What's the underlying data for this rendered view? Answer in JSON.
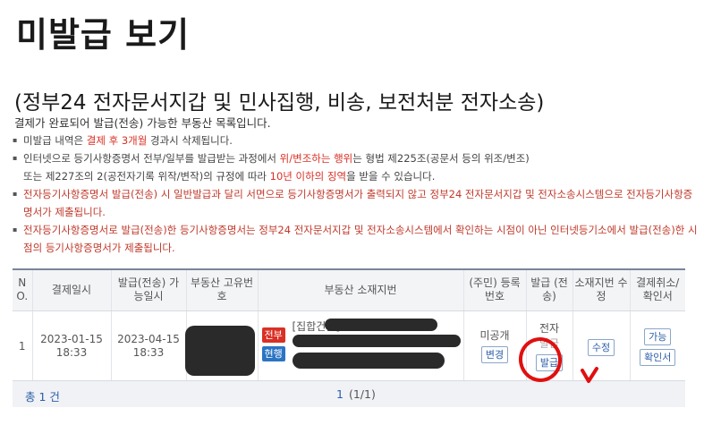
{
  "page": {
    "title": "미발급 보기",
    "section_title": "(정부24 전자문서지갑 및 민사집행, 비송, 보전처분 전자소송)",
    "intro": "결제가 완료되어 발급(전송) 가능한 부동산 목록입니다."
  },
  "notes": {
    "n1_a": "미발급 내역은 ",
    "n1_b": "결제 후 3개월",
    "n1_c": " 경과시 삭제됩니다.",
    "n2_a": "인터넷으로 등기사항증명서 전부/일부를 발급받는 과정에서 ",
    "n2_b": "위/변조하는 행위",
    "n2_c": "는 형법 제225조(공문서 등의 위조/변조)",
    "n2_d": "또는 제227조의 2(공전자기록 위작/변작)의 규정에 따라 ",
    "n2_e": "10년 이하의 징역",
    "n2_f": "을 받을 수 있습니다.",
    "n3": "전자등기사항증명서 발급(전송) 시 일반발급과 달리 서면으로 등기사항증명서가 출력되지 않고 정부24 전자문서지갑 및 전자소송시스템으로 전자등기사항증명서가 제출됩니다.",
    "n4": "전자등기사항증명서로 발급(전송)한 등기사항증명서는 정부24 전자문서지갑 및 전자소송시스템에서 확인하는 시점이 아닌 인터넷등기소에서 발급(전송)한 시점의 등기사항증명서가 제출됩니다."
  },
  "table": {
    "headers": [
      "N O.",
      "결제일시",
      "발급(전송) 가능일시",
      "부동산 고유번호",
      "부동산 소재지번",
      "(주민) 등록번호",
      "발급 (전송)",
      "소재지번 수정",
      "결제취소/확인서"
    ],
    "row": {
      "no": "1",
      "paid_date": "2023-01-15",
      "paid_time": "18:33",
      "avail_date": "2023-04-15",
      "avail_time": "18:33",
      "badge_all": "전부",
      "badge_current": "현행",
      "address_prefix": "[집합건물]",
      "reg_status": "미공개",
      "change_btn": "변경",
      "issue_text_1": "전자",
      "issue_text_2": "발급",
      "issue_btn": "발급",
      "edit_btn": "수정",
      "available_btn": "가능",
      "confirm_btn": "확인서"
    }
  },
  "footer": {
    "total": "총 1 건",
    "page_current": "1",
    "page_rest": "(1/1)"
  },
  "colors": {
    "accent_blue": "#2b5da8",
    "warning_red": "#d93025",
    "annotation_red": "#e01010"
  }
}
